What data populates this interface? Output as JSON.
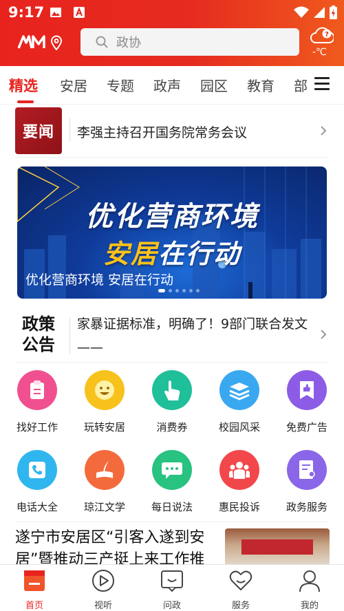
{
  "status_bar": {
    "time": "9:17"
  },
  "header": {
    "logo_text": "AM",
    "search_placeholder": "政协",
    "weather_temp": "-℃"
  },
  "tabs": [
    {
      "label": "精选",
      "active": true
    },
    {
      "label": "安居"
    },
    {
      "label": "专题"
    },
    {
      "label": "政声"
    },
    {
      "label": "园区"
    },
    {
      "label": "教育"
    },
    {
      "label": "部"
    }
  ],
  "headline": {
    "badge": "要闻",
    "text": "李强主持召开国务院常务会议"
  },
  "banner": {
    "line1": "优化营商环境",
    "line2_highlight": "安居",
    "line2_rest": "在行动",
    "caption": "优化营商环境 安居在行动"
  },
  "policy": {
    "badge_line1": "政策",
    "badge_line2": "公告",
    "text": "家暴证据标准，明确了！9部门联合发文——"
  },
  "services": [
    {
      "label": "找好工作",
      "icon": "clipboard-icon",
      "color": "#f0508f"
    },
    {
      "label": "玩转安居",
      "icon": "smiley-icon",
      "color": "#f7c21c"
    },
    {
      "label": "消费券",
      "icon": "pointing-hand-icon",
      "color": "#1fbf9a"
    },
    {
      "label": "校园风采",
      "icon": "books-icon",
      "color": "#3aa8f0"
    },
    {
      "label": "免费广告",
      "icon": "thumbs-up-icon",
      "color": "#8c5ce6"
    },
    {
      "label": "电话大全",
      "icon": "phone-icon",
      "color": "#2fb6ee"
    },
    {
      "label": "琼江文学",
      "icon": "quill-book-icon",
      "color": "#f36b3d"
    },
    {
      "label": "每日说法",
      "icon": "chat-bubble-icon",
      "color": "#28c281"
    },
    {
      "label": "惠民投诉",
      "icon": "people-icon",
      "color": "#f2474b"
    },
    {
      "label": "政务服务",
      "icon": "document-user-icon",
      "color": "#8a66e8"
    }
  ],
  "article": {
    "title": "遂宁市安居区“引客入遂到安居”暨推动三产挺上来工作推"
  },
  "bottom_nav": [
    {
      "label": "首页",
      "icon": "home-icon",
      "active": true
    },
    {
      "label": "视听",
      "icon": "play-icon"
    },
    {
      "label": "问政",
      "icon": "question-box-icon"
    },
    {
      "label": "服务",
      "icon": "heart-icon"
    },
    {
      "label": "我的",
      "icon": "user-icon"
    }
  ],
  "colors": {
    "brand_red": "#e8231e",
    "accent_yellow": "#ffc21a"
  }
}
